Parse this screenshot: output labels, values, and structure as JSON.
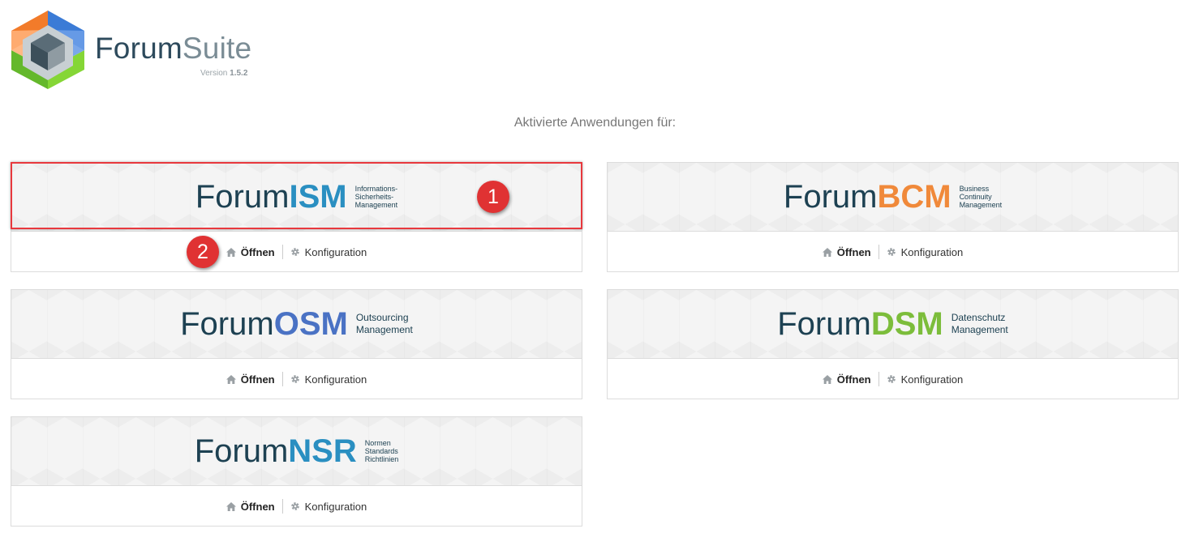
{
  "header": {
    "brand_part1": "Forum",
    "brand_part2": "Suite",
    "version_label": "Version",
    "version_number": "1.5.2"
  },
  "heading": "Aktivierte Anwendungen für:",
  "actions": {
    "open_label": "Öffnen",
    "config_label": "Konfiguration"
  },
  "apps": [
    {
      "prefix": "Forum",
      "suffix": "ISM",
      "color": "#2a8fc1",
      "desc": [
        "Informations-",
        "Sicherheits-",
        "Management"
      ]
    },
    {
      "prefix": "Forum",
      "suffix": "BCM",
      "color": "#f0893a",
      "desc": [
        "Business",
        "Continuity",
        "Management"
      ]
    },
    {
      "prefix": "Forum",
      "suffix": "OSM",
      "color": "#4a72c4",
      "desc": [
        "Outsourcing",
        "Management"
      ]
    },
    {
      "prefix": "Forum",
      "suffix": "DSM",
      "color": "#7cbd3b",
      "desc": [
        "Datenschutz",
        "Management"
      ]
    },
    {
      "prefix": "Forum",
      "suffix": "NSR",
      "color": "#2a8fc1",
      "desc": [
        "Normen",
        "Standards",
        "Richtlinien"
      ]
    }
  ],
  "annotations": [
    "1",
    "2"
  ],
  "colors": {
    "logo_orange": "#f27b2a",
    "logo_blue": "#3b7bd6",
    "logo_green": "#7ccc2f",
    "annotation_red": "#e03233"
  },
  "icons": {
    "open": "home-icon",
    "config": "gear-icon"
  }
}
